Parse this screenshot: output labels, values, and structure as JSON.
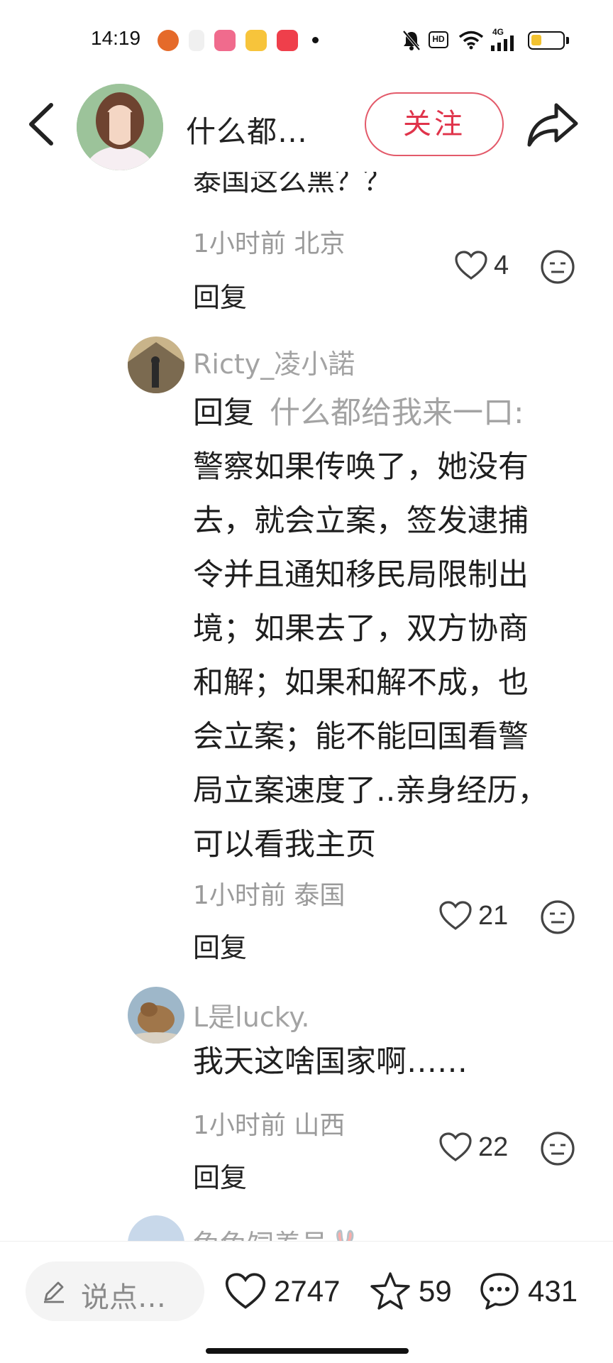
{
  "status_bar": {
    "time": "14:19",
    "network": "4G",
    "hd_label": "HD"
  },
  "header": {
    "title": "什么都…",
    "follow_label": "关注"
  },
  "comments": {
    "cut_off_text": "泰国这么黑？？",
    "first": {
      "meta": "1小时前 北京",
      "likes": "4",
      "reply_label": "回复"
    },
    "second": {
      "author": "Ricty_凌小諾",
      "reply_prefix": "回复",
      "reply_to": "什么都给我来一口:",
      "lines": [
        "警察如果传唤了，她没有",
        "去，就会立案，签发逮捕",
        "令并且通知移民局限制出",
        "境；如果去了，双方协商",
        "和解；如果和解不成，也",
        "会立案；能不能回国看警",
        "局立案速度了..亲身经历，",
        "可以看我主页"
      ],
      "meta": "1小时前 泰国",
      "likes": "21",
      "reply_label": "回复"
    },
    "third": {
      "author": "L是lucky.",
      "text": "我天这啥国家啊……",
      "meta": "1小时前 山西",
      "likes": "22",
      "reply_label": "回复"
    },
    "fourth": {
      "author": "兔兔饲养员🐰"
    }
  },
  "bottom_bar": {
    "input_placeholder": "说点…",
    "likes": "2747",
    "favorites": "59",
    "comments": "431"
  },
  "colors": {
    "accent": "#e0344b",
    "meta_gray": "#9a9a9a"
  }
}
